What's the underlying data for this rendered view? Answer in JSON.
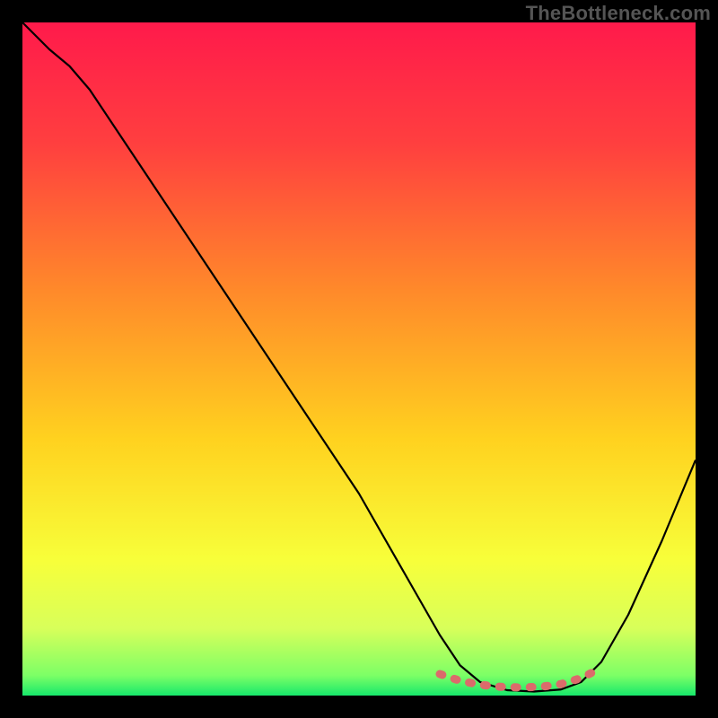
{
  "watermark": "TheBottleneck.com",
  "chart_data": {
    "type": "line",
    "title": "",
    "xlabel": "",
    "ylabel": "",
    "xlim": [
      0,
      100
    ],
    "ylim": [
      0,
      100
    ],
    "gradient_stops": [
      {
        "offset": 0,
        "color": "#ff1a4b"
      },
      {
        "offset": 18,
        "color": "#ff3f3f"
      },
      {
        "offset": 40,
        "color": "#ff8a2a"
      },
      {
        "offset": 62,
        "color": "#ffd21f"
      },
      {
        "offset": 80,
        "color": "#f7ff3a"
      },
      {
        "offset": 90,
        "color": "#d8ff5a"
      },
      {
        "offset": 97,
        "color": "#7dff66"
      },
      {
        "offset": 100,
        "color": "#17e86b"
      }
    ],
    "series": [
      {
        "name": "bottleneck-curve",
        "stroke": "#000000",
        "stroke_width": 2.2,
        "points": [
          {
            "x": 0,
            "y": 100
          },
          {
            "x": 4,
            "y": 96
          },
          {
            "x": 7,
            "y": 93.5
          },
          {
            "x": 10,
            "y": 90
          },
          {
            "x": 20,
            "y": 75
          },
          {
            "x": 30,
            "y": 60
          },
          {
            "x": 40,
            "y": 45
          },
          {
            "x": 50,
            "y": 30
          },
          {
            "x": 58,
            "y": 16
          },
          {
            "x": 62,
            "y": 9
          },
          {
            "x": 65,
            "y": 4.5
          },
          {
            "x": 68,
            "y": 2
          },
          {
            "x": 72,
            "y": 0.8
          },
          {
            "x": 76,
            "y": 0.6
          },
          {
            "x": 80,
            "y": 0.9
          },
          {
            "x": 83,
            "y": 2
          },
          {
            "x": 86,
            "y": 5
          },
          {
            "x": 90,
            "y": 12
          },
          {
            "x": 95,
            "y": 23
          },
          {
            "x": 100,
            "y": 35
          }
        ]
      },
      {
        "name": "optimum-marker",
        "stroke": "#db6b6b",
        "stroke_width": 9,
        "dash": [
          3,
          14
        ],
        "linecap": "round",
        "points": [
          {
            "x": 62,
            "y": 3.2
          },
          {
            "x": 65,
            "y": 2.2
          },
          {
            "x": 68,
            "y": 1.6
          },
          {
            "x": 71,
            "y": 1.3
          },
          {
            "x": 74,
            "y": 1.2
          },
          {
            "x": 77,
            "y": 1.3
          },
          {
            "x": 80,
            "y": 1.7
          },
          {
            "x": 83,
            "y": 2.6
          },
          {
            "x": 85,
            "y": 3.6
          }
        ]
      }
    ]
  }
}
